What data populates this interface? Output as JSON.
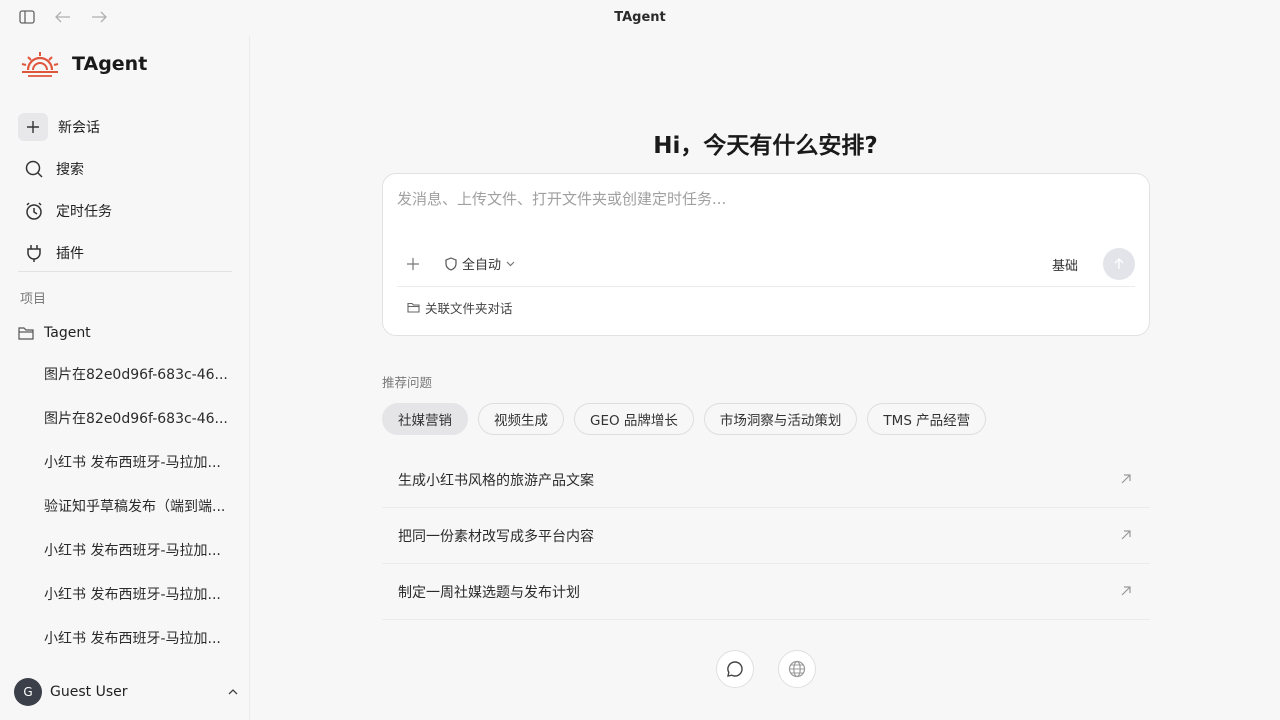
{
  "window": {
    "title": "TAgent"
  },
  "brand": {
    "name": "TAgent"
  },
  "nav": {
    "new_chat": "新会话",
    "search": "搜索",
    "scheduled": "定时任务",
    "plugins": "插件"
  },
  "sidebar": {
    "section_label": "项目",
    "project_name": "Tagent",
    "conversations": [
      "图片在82e0d96f-683c-46...",
      "图片在82e0d96f-683c-46...",
      "小红书 发布西班牙-马拉加...",
      "验证知乎草稿发布（端到端...",
      "小红书 发布西班牙-马拉加...",
      "小红书 发布西班牙-马拉加...",
      "小红书 发布西班牙-马拉加..."
    ]
  },
  "user": {
    "initial": "G",
    "name": "Guest User"
  },
  "main": {
    "greeting": "Hi，今天有什么安排?",
    "composer": {
      "placeholder": "发消息、上传文件、打开文件夹或创建定时任务...",
      "mode": "全自动",
      "level": "基础",
      "folder_link": "关联文件夹对话"
    },
    "rec_label": "推荐问题",
    "chips": [
      "社媒营销",
      "视频生成",
      "GEO 品牌增长",
      "市场洞察与活动策划",
      "TMS 产品经营"
    ],
    "suggestions": [
      "生成小红书风格的旅游产品文案",
      "把同一份素材改写成多平台内容",
      "制定一周社媒选题与发布计划"
    ]
  },
  "colors": {
    "brand_accent": "#e0563b"
  }
}
